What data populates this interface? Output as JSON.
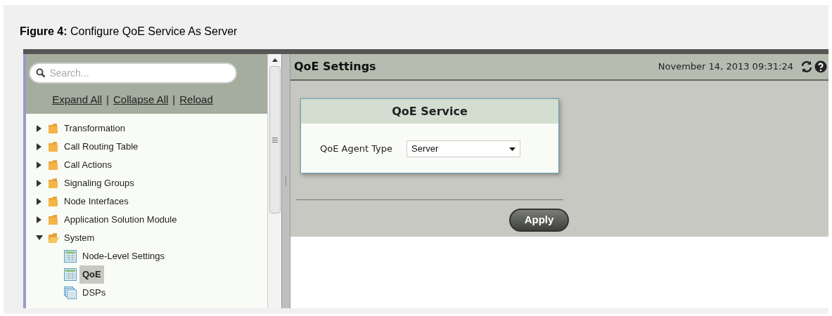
{
  "caption": {
    "text": "**Figure 4:** Configure QoE Service As Server"
  },
  "sidebar": {
    "search": {
      "placeholder": "Search..."
    },
    "links": [
      "Expand All",
      "Collapse All",
      "Reload"
    ],
    "separators": [
      "|",
      "|"
    ],
    "tree": [
      {
        "label": "Transformation",
        "expanded": false
      },
      {
        "label": "Call Routing Table",
        "expanded": false
      },
      {
        "label": "Call Actions",
        "expanded": false
      },
      {
        "label": "Signaling Groups",
        "expanded": false
      },
      {
        "label": "Node Interfaces",
        "expanded": false
      },
      {
        "label": "Application Solution Module",
        "expanded": false
      },
      {
        "label": "System",
        "expanded": true,
        "children": [
          {
            "label": "Node-Level Settings",
            "kind": "table",
            "selected": false
          },
          {
            "label": "QoE",
            "kind": "table",
            "selected": true
          },
          {
            "label": "DSPs",
            "kind": "stack",
            "selected": false
          }
        ]
      }
    ]
  },
  "main": {
    "title": "QoE Settings",
    "datetime": "November 14, 2013 09:31:24",
    "card": {
      "title": "QoE Service",
      "field": {
        "label": "QoE Agent Type",
        "value": "Server"
      }
    },
    "apply": "Apply"
  }
}
